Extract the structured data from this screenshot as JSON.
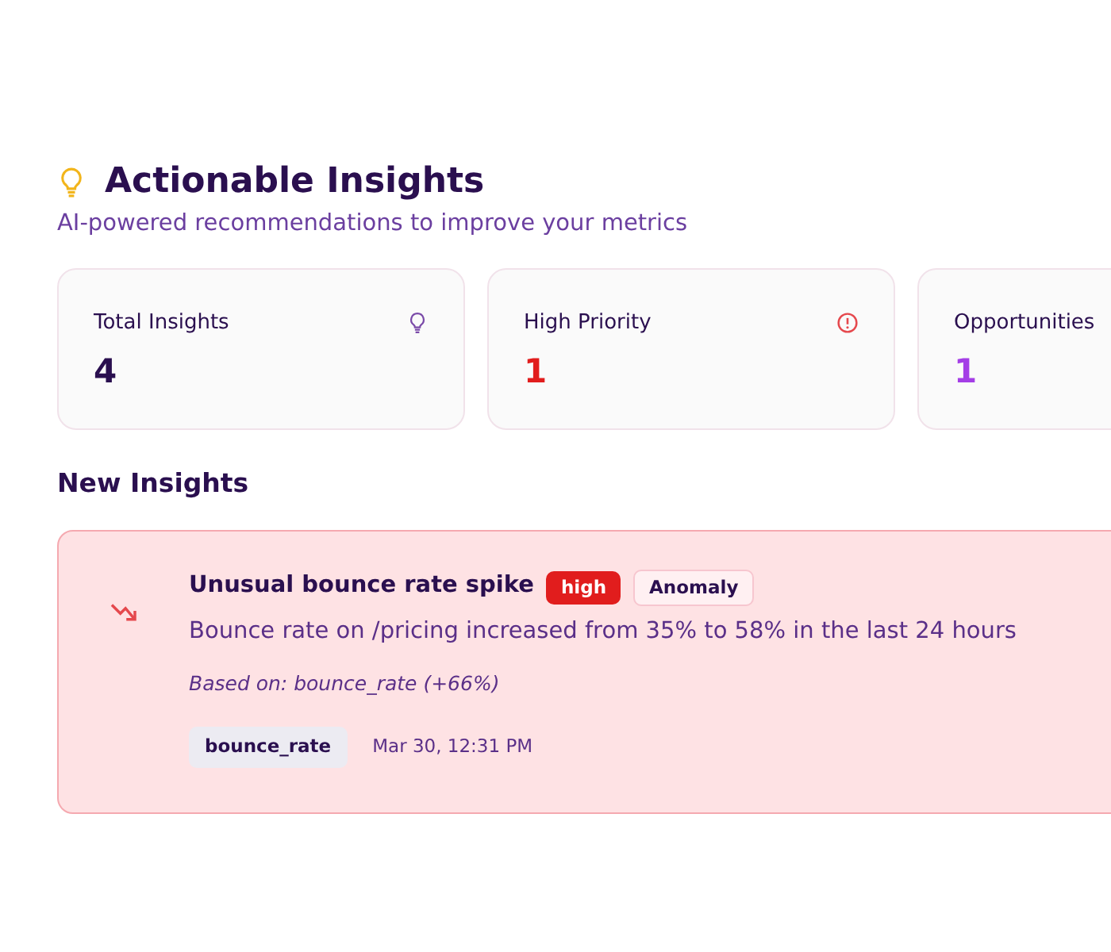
{
  "header": {
    "title": "Actionable Insights",
    "subtitle": "AI-powered recommendations to improve your metrics"
  },
  "stats": [
    {
      "kind": "total",
      "label": "Total Insights",
      "value": "4"
    },
    {
      "kind": "priority",
      "label": "High Priority",
      "value": "1"
    },
    {
      "kind": "opportunity",
      "label": "Opportunities",
      "value": "1"
    }
  ],
  "section_title": "New Insights",
  "insights": [
    {
      "kind": "decline",
      "title": "Unusual bounce rate spike",
      "priority": "high",
      "category": "Anomaly",
      "description": "Bounce rate on /pricing increased from 35% to 58% in the last 24 hours",
      "basis": "Based on: bounce_rate (+66%)",
      "metric": "bounce_rate",
      "time": "Mar 30, 12:31 PM"
    }
  ]
}
